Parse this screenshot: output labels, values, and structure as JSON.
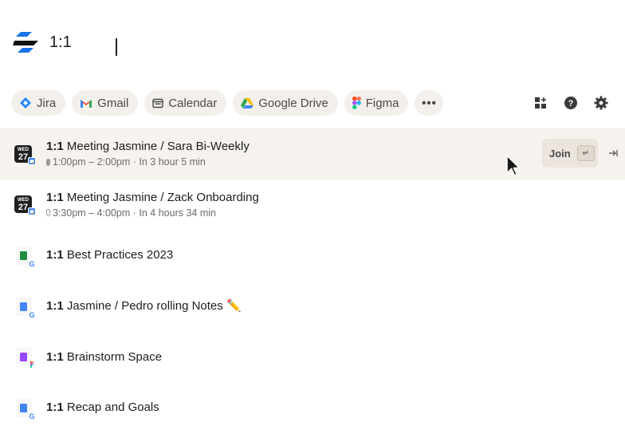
{
  "search": {
    "query": "1:1"
  },
  "filters": [
    {
      "label": "Jira",
      "icon": "jira-icon"
    },
    {
      "label": "Gmail",
      "icon": "gmail-icon"
    },
    {
      "label": "Calendar",
      "icon": "calendar-icon"
    },
    {
      "label": "Google Drive",
      "icon": "google-drive-icon"
    },
    {
      "label": "Figma",
      "icon": "figma-icon"
    },
    {
      "label": "•••",
      "icon": "more-icon"
    }
  ],
  "tools": [
    "grid-plus-icon",
    "help-icon",
    "gear-icon"
  ],
  "results": [
    {
      "bold": "1:1",
      "title": " Meeting Jasmine / Sara Bi-Weekly",
      "sub": "1:00pm – 2:00pm · In 3 hour 5 min",
      "type": "event",
      "dow": "WED",
      "day": "27"
    },
    {
      "bold": "1:1",
      "title": " Meeting Jasmine / Zack Onboarding",
      "sub": "3:30pm – 4:00pm · In 4 hours 34 min",
      "type": "event",
      "dow": "WED",
      "day": "27"
    },
    {
      "bold": "1:1",
      "title": " Best Practices 2023",
      "type": "sheet"
    },
    {
      "bold": "1:1",
      "title": " Jasmine / Pedro rolling Notes ✏️",
      "type": "doc"
    },
    {
      "bold": "1:1",
      "title": " Brainstorm Space",
      "type": "figjam"
    },
    {
      "bold": "1:1",
      "title": " Recap and Goals",
      "type": "doc"
    }
  ],
  "join": {
    "label": "Join",
    "key": "↵"
  },
  "colors": {
    "selected_row": "#f6f3ef",
    "chip_bg": "#f3f0ec",
    "join_bg": "#ebe5dd"
  }
}
